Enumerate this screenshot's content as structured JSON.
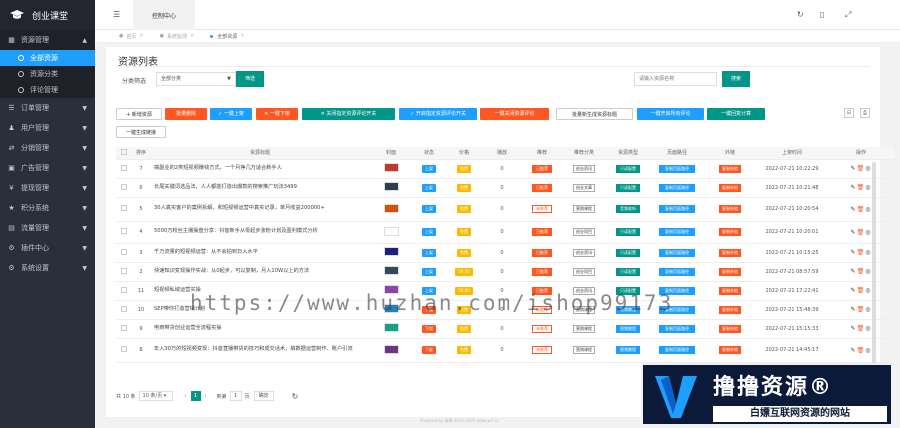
{
  "app": {
    "title": "创业课堂"
  },
  "sidebar": {
    "groups": [
      {
        "label": "资源管理",
        "icon": "grid-icon",
        "open": true,
        "subs": [
          {
            "label": "全部资源",
            "active": true
          },
          {
            "label": "资源分类"
          },
          {
            "label": "评论管理"
          }
        ]
      },
      {
        "label": "订单管理",
        "icon": "list-icon"
      },
      {
        "label": "用户管理",
        "icon": "user-icon"
      },
      {
        "label": "分销管理",
        "icon": "share-icon"
      },
      {
        "label": "广告管理",
        "icon": "ad-icon"
      },
      {
        "label": "提现管理",
        "icon": "money-icon"
      },
      {
        "label": "积分系统",
        "icon": "star-icon"
      },
      {
        "label": "流量管理",
        "icon": "chart-icon"
      },
      {
        "label": "插件中心",
        "icon": "plugin-icon"
      },
      {
        "label": "系统设置",
        "icon": "gear-icon"
      }
    ]
  },
  "topbar": {
    "active_tab": "控制中心"
  },
  "tabs": [
    {
      "label": "首页"
    },
    {
      "label": "系统监测"
    },
    {
      "label": "全部资源",
      "active": true
    }
  ],
  "page": {
    "title": "资源列表"
  },
  "filter": {
    "label": "分类筛选",
    "select_value": "全部分类",
    "filter_button": "筛选",
    "search_placeholder": "请输入资源名称",
    "search_button": "搜索"
  },
  "actions": [
    {
      "label": "+ 新增资源",
      "style": "white"
    },
    {
      "label": "批量删除",
      "style": "orange"
    },
    {
      "label": "✓ 一键上架",
      "style": "blue"
    },
    {
      "label": "✕ 一键下架",
      "style": "orange"
    },
    {
      "label": "✕ 关闭指定资源评论开关",
      "style": "teal"
    },
    {
      "label": "✓ 开启指定资源评论开关",
      "style": "blue"
    },
    {
      "label": "一键关闭资源评论",
      "style": "orange"
    },
    {
      "label": "批量新生成资源标题",
      "style": "white"
    },
    {
      "label": "一键开启所有评论",
      "style": "blue"
    },
    {
      "label": "一键回复计算",
      "style": "teal"
    },
    {
      "label": "一键生成链接",
      "style": "white"
    }
  ],
  "table": {
    "headers": [
      "",
      "排序",
      "资源标题",
      "封面",
      "状态",
      "价格",
      "播放",
      "推荐",
      "推荐分类",
      "资源类型",
      "页面路径",
      "外链",
      "上架时间",
      "操作"
    ],
    "rows": [
      {
        "sort": "7",
        "title": "搞副业的2类短视频赚钱方式，一个月挣几万适合新手人",
        "thumb": "#c0392b",
        "status": "上架",
        "price": "免费",
        "plays": "0",
        "rec": "已推荐",
        "cat": "创业资讯",
        "type": "只读配置",
        "path": "复制页面路径",
        "link": "复制外链",
        "time": "2022-07-21 10:22:29"
      },
      {
        "sort": "6",
        "title": "长尾关键词选品法，人人都能打造出爆款的搜索推广玩法3499",
        "thumb": "#2c3e50",
        "status": "上架",
        "price": "免费",
        "plays": "0",
        "rec": "已推荐",
        "cat": "创业文章",
        "type": "只读配置",
        "path": "复制页面路径",
        "link": "复制外链",
        "time": "2022-07-21 10:21:48"
      },
      {
        "sort": "5",
        "title": "30人真实客户的案例拆解，和短视频运营中真实记录，单月收益200000+",
        "thumb": "#d35400",
        "status": "上架",
        "price": "免费",
        "plays": "0",
        "rec": "未推荐",
        "cat": "营销课程",
        "type": "音频收听",
        "path": "复制页面路径",
        "link": "复制外链",
        "time": "2022-07-21 10:20:54"
      },
      {
        "sort": "4",
        "title": "5000万粉丝主播操盘分享：抖音新手从零起步涨粉计划及盈利模式分析",
        "thumb": "#ffffff",
        "status": "上架",
        "price": "免费",
        "plays": "0",
        "rec": "已推荐",
        "cat": "创业项目",
        "type": "只读配置",
        "path": "复制页面路径",
        "link": "复制外链",
        "time": "2022-07-21 10:20:01"
      },
      {
        "sort": "3",
        "title": "千万流量的短视频运营：从不会拍到日入水平",
        "thumb": "#1a237e",
        "status": "上架",
        "price": "免费",
        "plays": "0",
        "rec": "已推荐",
        "cat": "创业资讯",
        "type": "只读配置",
        "path": "复制页面路径",
        "link": "复制外链",
        "time": "2022-07-21 10:15:25"
      },
      {
        "sort": "2",
        "title": "快速知识变现操作实战：从0起步，可以复制，月入10W以上的方法",
        "thumb": "#34495e",
        "status": "上架",
        "price": "59.00",
        "plays": "0",
        "rec": "已推荐",
        "cat": "创业项目",
        "type": "只读配置",
        "path": "复制页面路径",
        "link": "复制外链",
        "time": "2022-07-21 08:57:59"
      },
      {
        "sort": "11",
        "title": "短视频私域运营实操",
        "thumb": "#8e44ad",
        "status": "上架",
        "price": "59.00",
        "plays": "0",
        "rec": "已推荐",
        "cat": "创业资讯",
        "type": "只读配置",
        "path": "复制页面路径",
        "link": "复制外链",
        "time": "2022-07-21 17:22:41"
      },
      {
        "sort": "10",
        "title": "SEP带你打造营销计划",
        "thumb": "#2980b9",
        "status": "下架",
        "price": "免费",
        "plays": "0",
        "rec": "未推荐",
        "cat": "营销课程",
        "type": "视频教程",
        "path": "复制页面路径",
        "link": "复制外链",
        "time": "2022-07-21 15:48:39"
      },
      {
        "sort": "9",
        "title": "电商带货创业运营全流程实操",
        "thumb": "#16a085",
        "status": "下架",
        "price": "免费",
        "plays": "0",
        "rec": "未推荐",
        "cat": "营销课程",
        "type": "视频教程",
        "path": "复制页面路径",
        "link": "复制外链",
        "time": "2022-07-21 15:15:33"
      },
      {
        "sort": "8",
        "title": "年入30万的短视频变现：抖音直播带货的技巧和成交话术，搞数据运营制作、账户引流",
        "thumb": "#6c3483",
        "status": "下架",
        "price": "免费",
        "plays": "0",
        "rec": "未推荐",
        "cat": "营销课程",
        "type": "视频教程",
        "path": "复制页面路径",
        "link": "复制外链",
        "time": "2022-07-21 14:45:17"
      }
    ]
  },
  "pager": {
    "total": "共 10 条",
    "per_page": "10 条/页",
    "page": "1",
    "goto": "到第",
    "page_input": "1",
    "unit": "页",
    "confirm": "确定"
  },
  "footer": "Powered by 微擎 2014-2020 www.w7.cc",
  "watermark": {
    "url": "https://www.huzhan.com/ishop99173",
    "brand": "撸撸资源®",
    "slogan": "白嫖互联网资源的网站"
  },
  "colors": {
    "sidebar": "#2b2e3b",
    "accent": "#1e9fff",
    "green": "#009688",
    "orange": "#ff5722"
  }
}
